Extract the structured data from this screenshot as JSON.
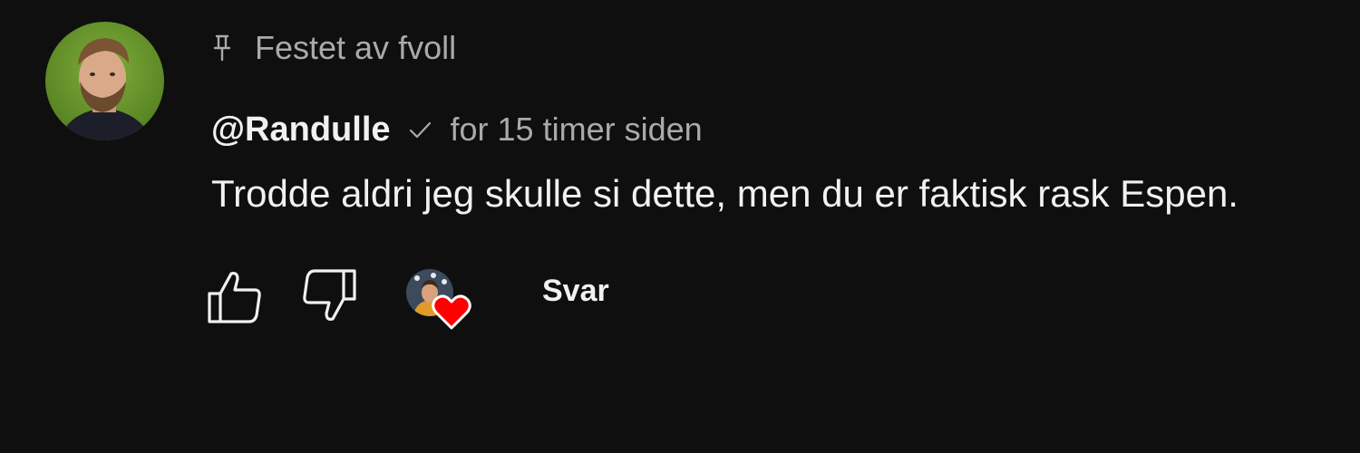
{
  "pinned": {
    "label": "Festet av fvoll",
    "icon": "pin-icon"
  },
  "comment": {
    "author": "@Randulle",
    "verified_icon": "checkmark-icon",
    "timestamp": "for 15 timer siden",
    "text": "Trodde aldri jeg skulle si dette, men du er faktisk rask Espen."
  },
  "actions": {
    "like_icon": "thumbs-up-icon",
    "dislike_icon": "thumbs-down-icon",
    "creator_heart_icon": "heart-icon",
    "reply_label": "Svar"
  },
  "colors": {
    "background": "#0f0f0f",
    "primary_text": "#f1f1f1",
    "secondary_text": "#aaaaaa",
    "heart": "#ff0000"
  }
}
